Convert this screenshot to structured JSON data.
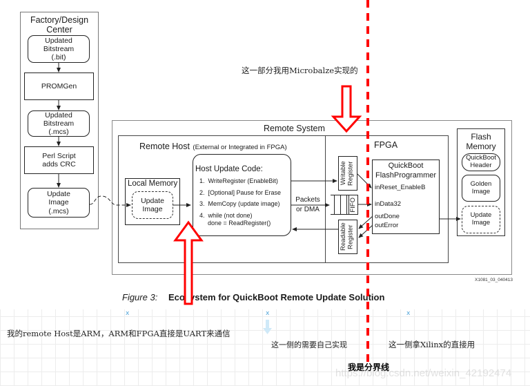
{
  "factory": {
    "title": "Factory/Design Center",
    "steps": [
      {
        "label": "Updated Bitstream (.bit)",
        "shape": "rounded"
      },
      {
        "label": "PROMGen",
        "shape": "rect"
      },
      {
        "label": "Updated Bitstream (.mcs)",
        "shape": "rounded"
      },
      {
        "label": "Perl Script adds CRC",
        "shape": "rect"
      },
      {
        "label": "Update Image (.mcs)",
        "shape": "rounded"
      }
    ]
  },
  "remote_system": {
    "title": "Remote System",
    "remote_host": {
      "title": "Remote Host",
      "subtitle": "(External or Integrated in FPGA)",
      "local_memory": {
        "title": "Local Memory",
        "image_label": "Update Image"
      },
      "host_code": {
        "title": "Host Update Code:",
        "steps": [
          "1.  WriteRegister (EnableBit)",
          "2.  [Optional] Pause for Erase",
          "3.  MemCopy (update image)",
          "4.  while (not done)",
          "done = ReadRegister()"
        ]
      },
      "transport_label": "Packets or DMA"
    },
    "fpga": {
      "title": "FPGA",
      "writable_register": "Writable Register",
      "fifo": "FIFO",
      "readable_register": "Readable Register",
      "programmer": {
        "title": "QuickBoot FlashProgrammer",
        "ports": [
          "inReset_EnableB",
          "inData32",
          "outDone",
          "outError"
        ]
      }
    },
    "flash": {
      "title": "Flash Memory",
      "regions": [
        "QuickBoot Header",
        "Golden Image",
        "Update Image"
      ]
    },
    "figure_id": "X1081_03_040413"
  },
  "caption": {
    "label": "Figure 3:",
    "text": "Ecosystem for QuickBoot Remote Update Solution"
  },
  "annotations": {
    "microblaze_note": "这一部分我用Microbalze实现的",
    "host_note": "我的remote Host是ARM，ARM和FPGA直接是UART来通信",
    "self_impl_note": "这一侧的需要自己实现",
    "xilinx_note": "这一侧拿Xilinx的直接用",
    "divider_label": "我是分界线",
    "highlight_color": "#ff0000",
    "marker_glyph": "x"
  },
  "watermark": "https://blog.csdn.net/weixin_42192474"
}
